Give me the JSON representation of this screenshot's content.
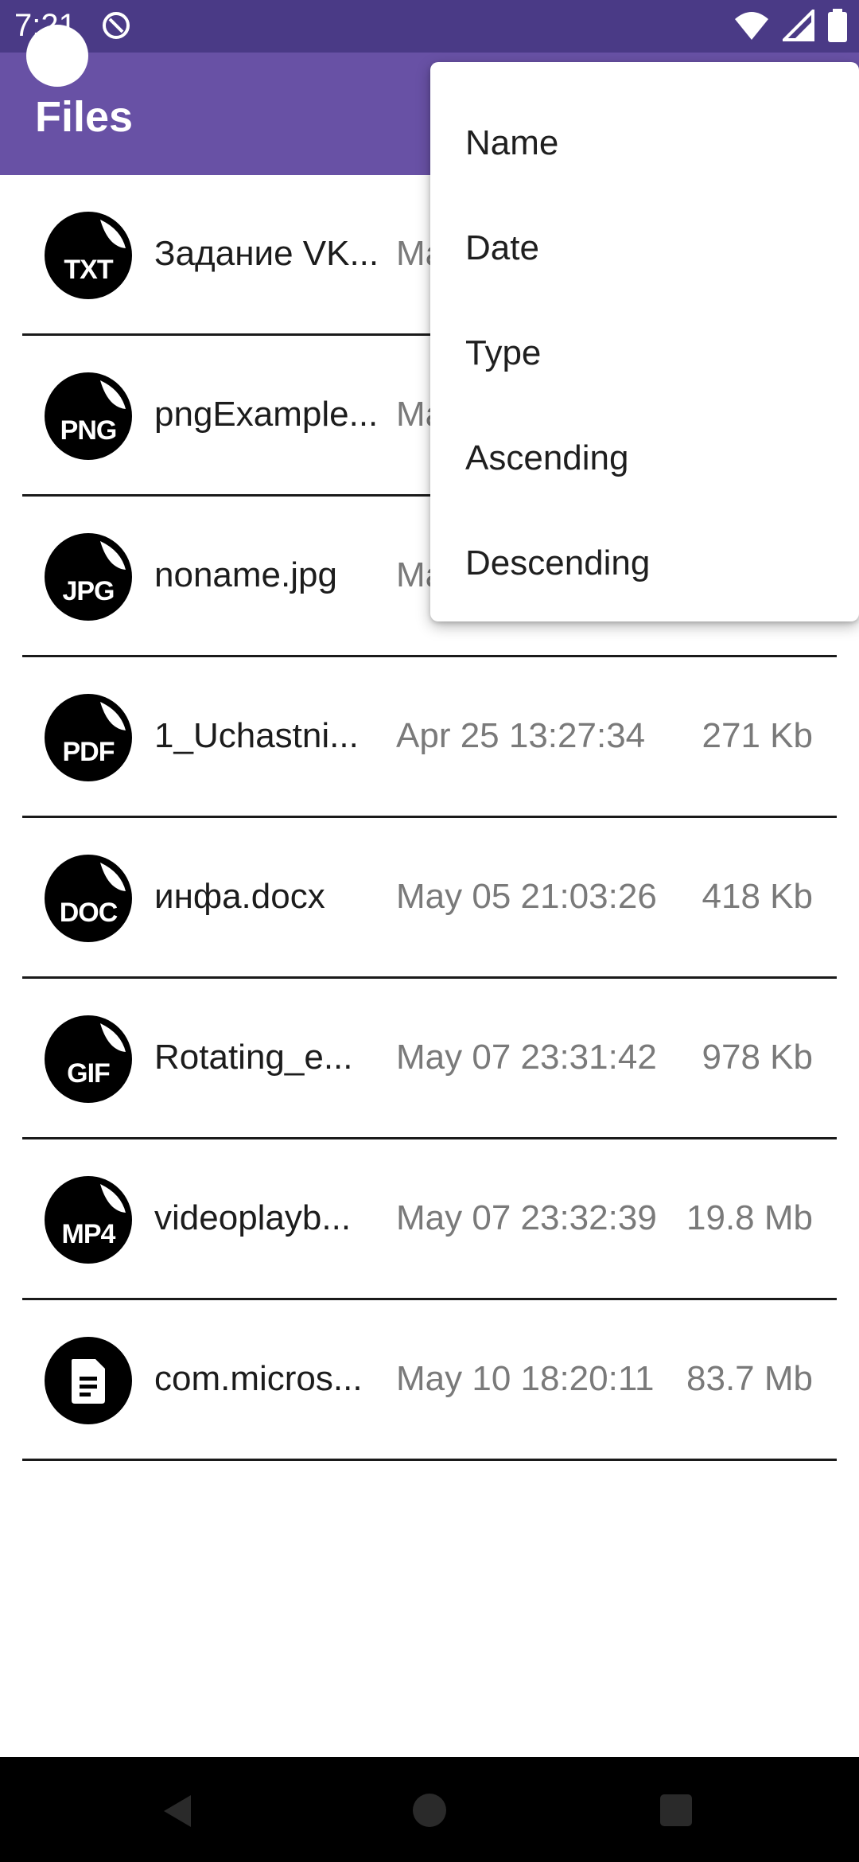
{
  "status_bar": {
    "time": "7:21",
    "icons": [
      "notification-icon",
      "wifi-icon",
      "signal-icon",
      "battery-icon"
    ]
  },
  "app_bar": {
    "title": "Files"
  },
  "files": [
    {
      "ext": "TXT",
      "icon": "txt-file-icon",
      "name": "Задание VK...",
      "date": "Ma",
      "size": ""
    },
    {
      "ext": "PNG",
      "icon": "png-file-icon",
      "name": "pngExample...",
      "date": "Ma",
      "size": ""
    },
    {
      "ext": "JPG",
      "icon": "jpg-file-icon",
      "name": "noname.jpg",
      "date": "Ma",
      "size": ""
    },
    {
      "ext": "PDF",
      "icon": "pdf-file-icon",
      "name": "1_Uchastni...",
      "date": "Apr 25 13:27:34",
      "size": "271 Kb"
    },
    {
      "ext": "DOC",
      "icon": "doc-file-icon",
      "name": "инфа.docx",
      "date": "May 05 21:03:26",
      "size": "418 Kb"
    },
    {
      "ext": "GIF",
      "icon": "gif-file-icon",
      "name": "Rotating_e...",
      "date": "May 07 23:31:42",
      "size": "978 Kb"
    },
    {
      "ext": "MP4",
      "icon": "mp4-file-icon",
      "name": "videoplayb...",
      "date": "May 07 23:32:39",
      "size": "19.8 Mb"
    },
    {
      "ext": "",
      "icon": "generic-document-icon",
      "name": "com.micros...",
      "date": "May 10 18:20:11",
      "size": "83.7 Mb"
    }
  ],
  "sort_menu": {
    "items": [
      "Name",
      "Date",
      "Type",
      "Ascending",
      "Descending"
    ]
  },
  "nav_bar": {
    "icons": [
      "back-icon",
      "home-icon",
      "recents-icon"
    ]
  },
  "colors": {
    "status_bar": "#4a3a86",
    "app_bar": "#6851a5",
    "icon_bg": "#000000",
    "secondary_text": "#7a7a7a"
  }
}
